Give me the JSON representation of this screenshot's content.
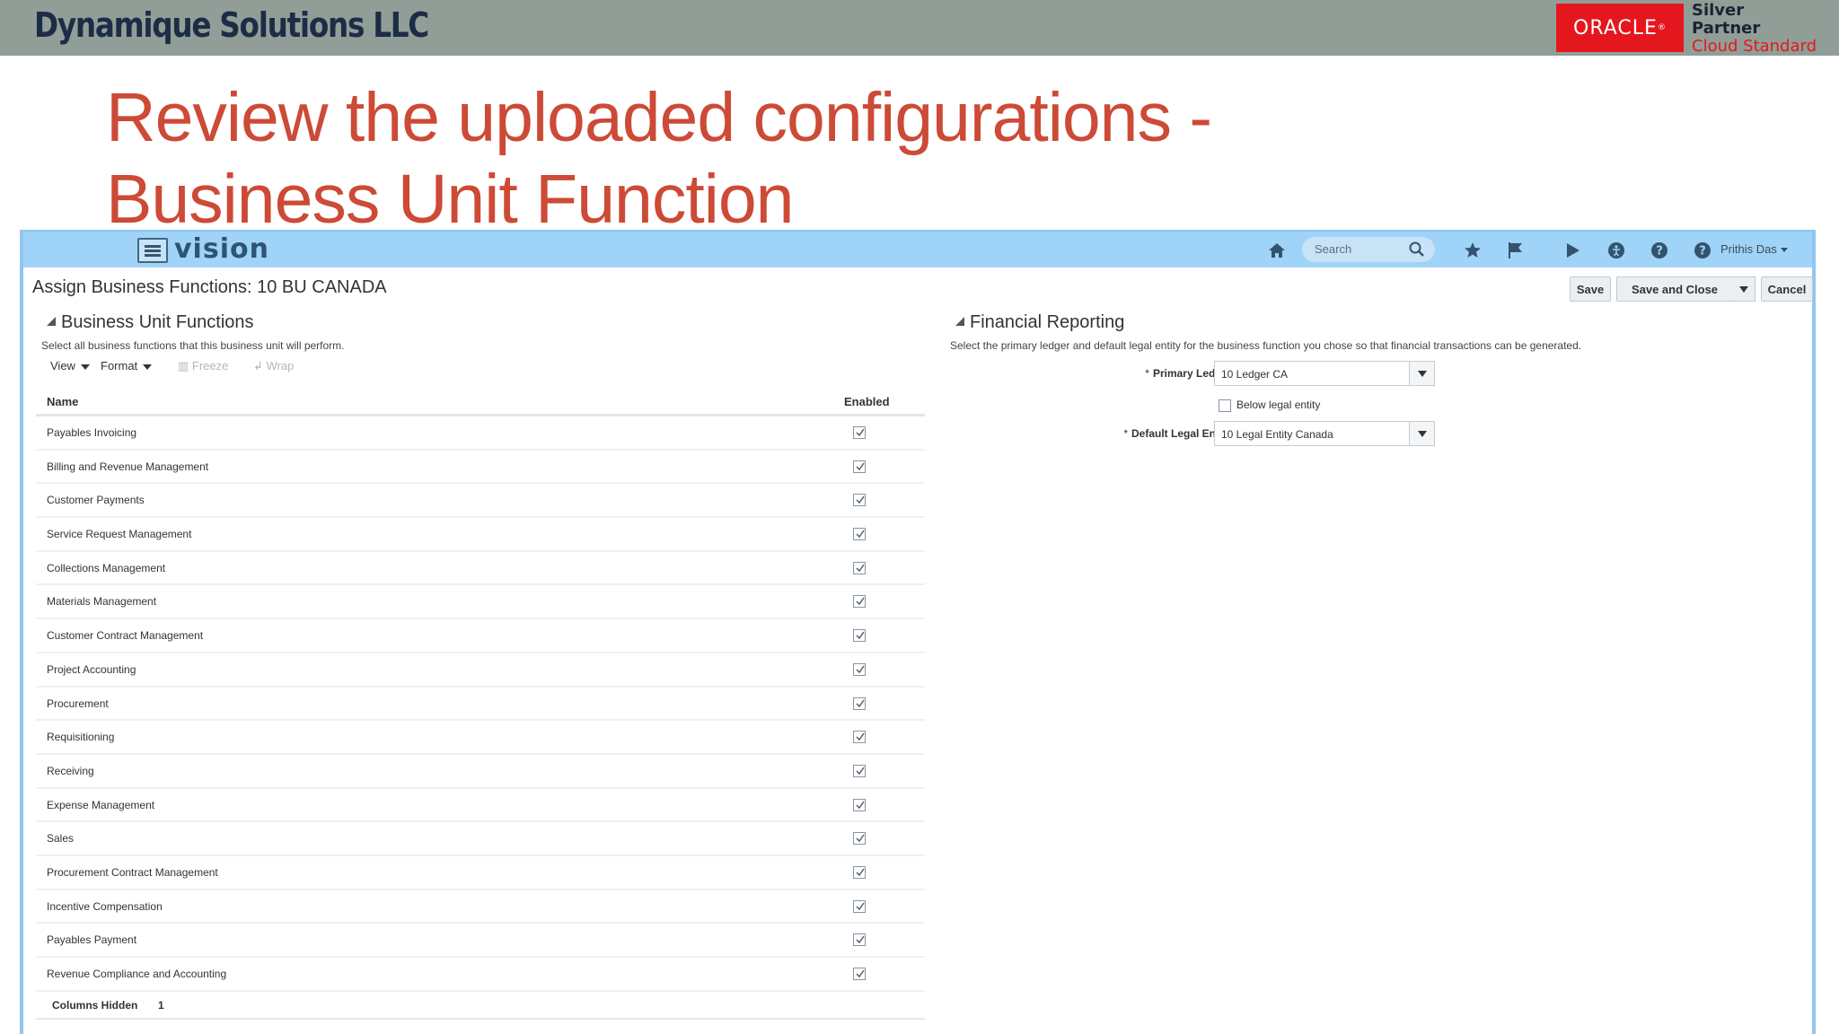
{
  "slide": {
    "company": "Dynamique Solutions LLC",
    "oracle_logo": "ORACLE",
    "partner_line1": "Silver",
    "partner_line2": "Partner",
    "partner_line3": "Cloud Standard",
    "title_line1": "Review the uploaded configurations -",
    "title_line2": "Business Unit Function",
    "colors": {
      "title": "#cc4a36",
      "oracle_red": "#e5171e",
      "band": "#909e97"
    }
  },
  "app": {
    "brand": "vision",
    "search_placeholder": "Search",
    "nav_icons": [
      "home-icon",
      "star-icon",
      "flag-icon",
      "notification-icon",
      "accessibility-icon",
      "help-icon",
      "help-icon"
    ],
    "user": "Prithis Das"
  },
  "page": {
    "title": "Assign Business Functions: 10 BU CANADA",
    "buttons": {
      "save": "Save",
      "save_close": "Save and Close",
      "cancel": "Cancel"
    }
  },
  "buf": {
    "title": "Business Unit Functions",
    "description": "Select all business functions that this business unit will perform.",
    "toolbar": {
      "view": "View",
      "format": "Format",
      "freeze": "Freeze",
      "wrap": "Wrap"
    },
    "columns": {
      "name": "Name",
      "enabled": "Enabled"
    },
    "rows": [
      {
        "name": "Payables Invoicing",
        "enabled": true
      },
      {
        "name": "Billing and Revenue Management",
        "enabled": true
      },
      {
        "name": "Customer Payments",
        "enabled": true
      },
      {
        "name": "Service Request Management",
        "enabled": true
      },
      {
        "name": "Collections Management",
        "enabled": true
      },
      {
        "name": "Materials Management",
        "enabled": true
      },
      {
        "name": "Customer Contract Management",
        "enabled": true
      },
      {
        "name": "Project Accounting",
        "enabled": true
      },
      {
        "name": "Procurement",
        "enabled": true
      },
      {
        "name": "Requisitioning",
        "enabled": true
      },
      {
        "name": "Receiving",
        "enabled": true
      },
      {
        "name": "Expense Management",
        "enabled": true
      },
      {
        "name": "Sales",
        "enabled": true
      },
      {
        "name": "Procurement Contract Management",
        "enabled": true
      },
      {
        "name": "Incentive Compensation",
        "enabled": true
      },
      {
        "name": "Payables Payment",
        "enabled": true
      },
      {
        "name": "Revenue Compliance and Accounting",
        "enabled": true
      }
    ],
    "footer_label": "Columns Hidden",
    "footer_value": "1"
  },
  "fr": {
    "title": "Financial Reporting",
    "description": "Select the primary ledger and default legal entity for the business function you chose so that financial transactions can be generated.",
    "required_mark": "*",
    "primary_ledger_label": "Primary Ledger",
    "primary_ledger_value": "10 Ledger CA",
    "below_legal_entity_label": "Below legal entity",
    "default_legal_entity_label": "Default Legal Entity",
    "default_legal_entity_value": "10 Legal Entity Canada"
  }
}
